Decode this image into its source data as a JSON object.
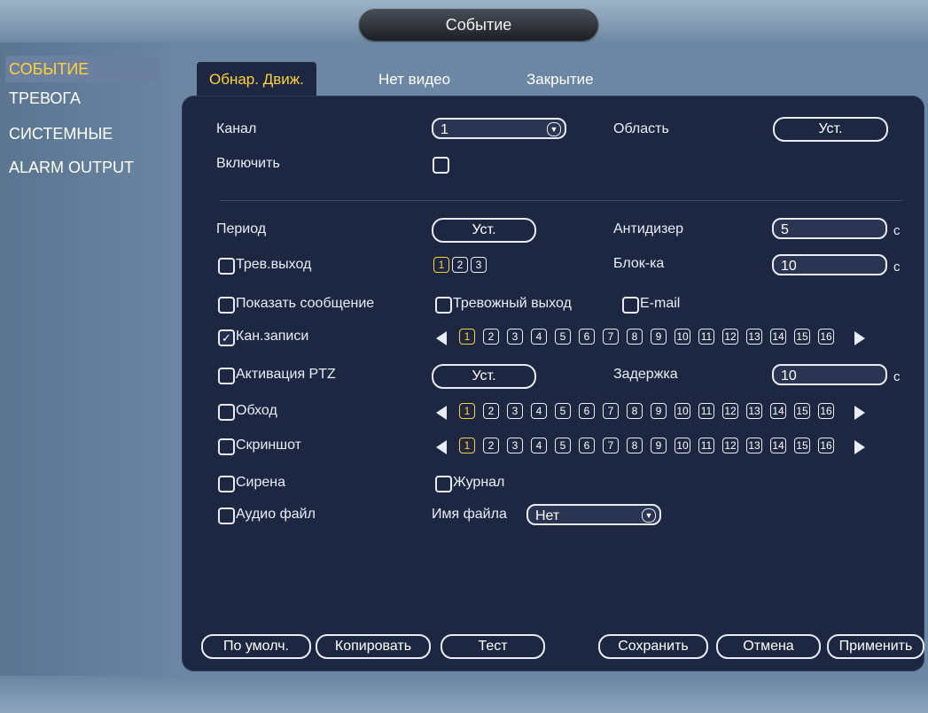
{
  "window": {
    "title": "Событие"
  },
  "sidebar": {
    "items": [
      {
        "label": "СОБЫТИЕ",
        "active": true
      },
      {
        "label": "ТРЕВОГА"
      },
      {
        "label": "СИСТЕМНЫЕ"
      },
      {
        "label": "ALARM OUTPUT"
      }
    ]
  },
  "tabs": [
    {
      "label": "Обнар. Движ.",
      "active": true
    },
    {
      "label": "Нет видео"
    },
    {
      "label": "Закрытие"
    }
  ],
  "form": {
    "channel_label": "Канал",
    "channel_value": "1",
    "area_label": "Область",
    "area_button": "Уст.",
    "enable_label": "Включить",
    "enable_checked": false,
    "period_label": "Период",
    "period_button": "Уст.",
    "antidither_label": "Антидизер",
    "antidither_value": "5",
    "antidither_unit": "c",
    "alarm_out_label": "Трев.выход",
    "alarm_out_nums": [
      "1",
      "2",
      "3"
    ],
    "latch_label": "Блок-ка",
    "latch_value": "10",
    "latch_unit": "c",
    "show_message_label": "Показать сообщение",
    "alarm_upload_label": "Тревожный выход",
    "email_label": "E-mail",
    "record_channel_label": "Кан.записи",
    "record_channel_checked": true,
    "ptz_label": "Активация PTZ",
    "ptz_button": "Уст.",
    "delay_label": "Задержка",
    "delay_value": "10",
    "delay_unit": "c",
    "tour_label": "Обход",
    "snapshot_label": "Скриншот",
    "siren_label": "Сирена",
    "log_label": "Журнал",
    "audio_label": "Аудио файл",
    "file_name_label": "Имя файла",
    "file_name_value": "Нет",
    "channel_nums": [
      "1",
      "2",
      "3",
      "4",
      "5",
      "6",
      "7",
      "8",
      "9",
      "10",
      "11",
      "12",
      "13",
      "14",
      "15",
      "16"
    ]
  },
  "footer": {
    "default_label": "По умолч.",
    "copy_label": "Копировать",
    "test_label": "Тест",
    "save_label": "Сохранить",
    "cancel_label": "Отмена",
    "apply_label": "Применить"
  },
  "colors": {
    "accent": "#ffd23a",
    "panel": "#1d2742"
  }
}
